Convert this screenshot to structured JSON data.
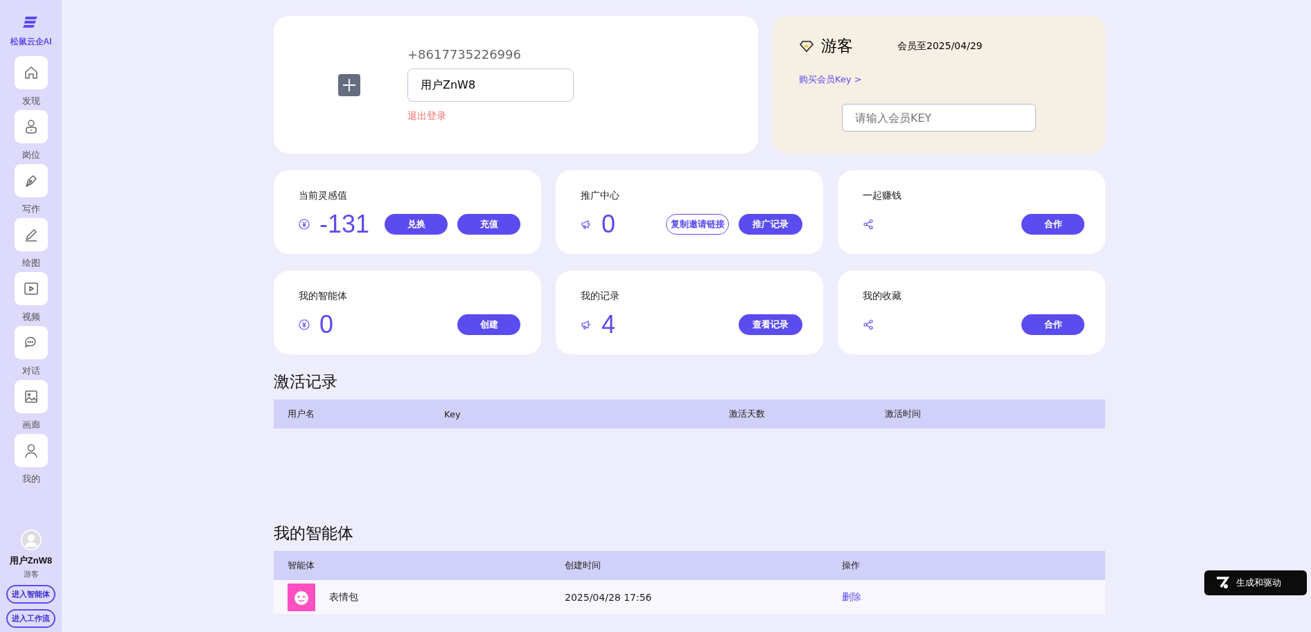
{
  "sidebar": {
    "brand": "松鼠云企AI",
    "items": [
      {
        "label": "发现",
        "kind": "home"
      },
      {
        "label": "岗位",
        "kind": "person"
      },
      {
        "label": "写作",
        "kind": "pen"
      },
      {
        "label": "绘图",
        "kind": "pencil"
      },
      {
        "label": "视频",
        "kind": "video"
      },
      {
        "label": "对话",
        "kind": "chat"
      },
      {
        "label": "画廊",
        "kind": "image"
      },
      {
        "label": "我的",
        "kind": "user"
      }
    ],
    "user": {
      "name": "用户ZnW8",
      "role": "游客"
    },
    "buttons": [
      "进入智能体",
      "进入工作流"
    ]
  },
  "profile": {
    "phone": "+8617735226996",
    "nickname": "用户ZnW8",
    "logout": "退出登录"
  },
  "membership": {
    "level": "游客",
    "expires": "会员至2025/04/29",
    "buy_link": "购买会员Key >",
    "key_placeholder": "请输入会员KEY"
  },
  "stat_cards": [
    {
      "title": "当前灵感值",
      "kind": "yen",
      "value": "-131",
      "buttons": [
        {
          "label": "兑换",
          "kind": "filled"
        },
        {
          "label": "充值",
          "kind": "filled"
        }
      ]
    },
    {
      "title": "推广中心",
      "kind": "megaphone",
      "value": "0",
      "buttons": [
        {
          "label": "复制邀请链接",
          "kind": "outline"
        },
        {
          "label": "推广记录",
          "kind": "filled"
        }
      ]
    },
    {
      "title": "一起赚钱",
      "kind": "share",
      "buttons": [
        {
          "label": "合作",
          "kind": "filled"
        }
      ]
    },
    {
      "title": "我的智能体",
      "kind": "yen",
      "value": "0",
      "buttons": [
        {
          "label": "创建",
          "kind": "filled"
        }
      ]
    },
    {
      "title": "我的记录",
      "kind": "megaphone",
      "value": "4",
      "buttons": [
        {
          "label": "查看记录",
          "kind": "filled"
        }
      ]
    },
    {
      "title": "我的收藏",
      "kind": "share",
      "buttons": [
        {
          "label": "合作",
          "kind": "filled"
        }
      ]
    }
  ],
  "activation_records": {
    "title": "激活记录",
    "columns": [
      "用户名",
      "Key",
      "激活天数",
      "激活时间"
    ]
  },
  "my_agents": {
    "title": "我的智能体",
    "columns": [
      "智能体",
      "创建时间",
      "操作"
    ],
    "rows": [
      {
        "name": "表情包",
        "created": "2025/04/28 17:56",
        "action": "删除"
      }
    ]
  },
  "badge": {
    "label": "生成和驱动"
  }
}
